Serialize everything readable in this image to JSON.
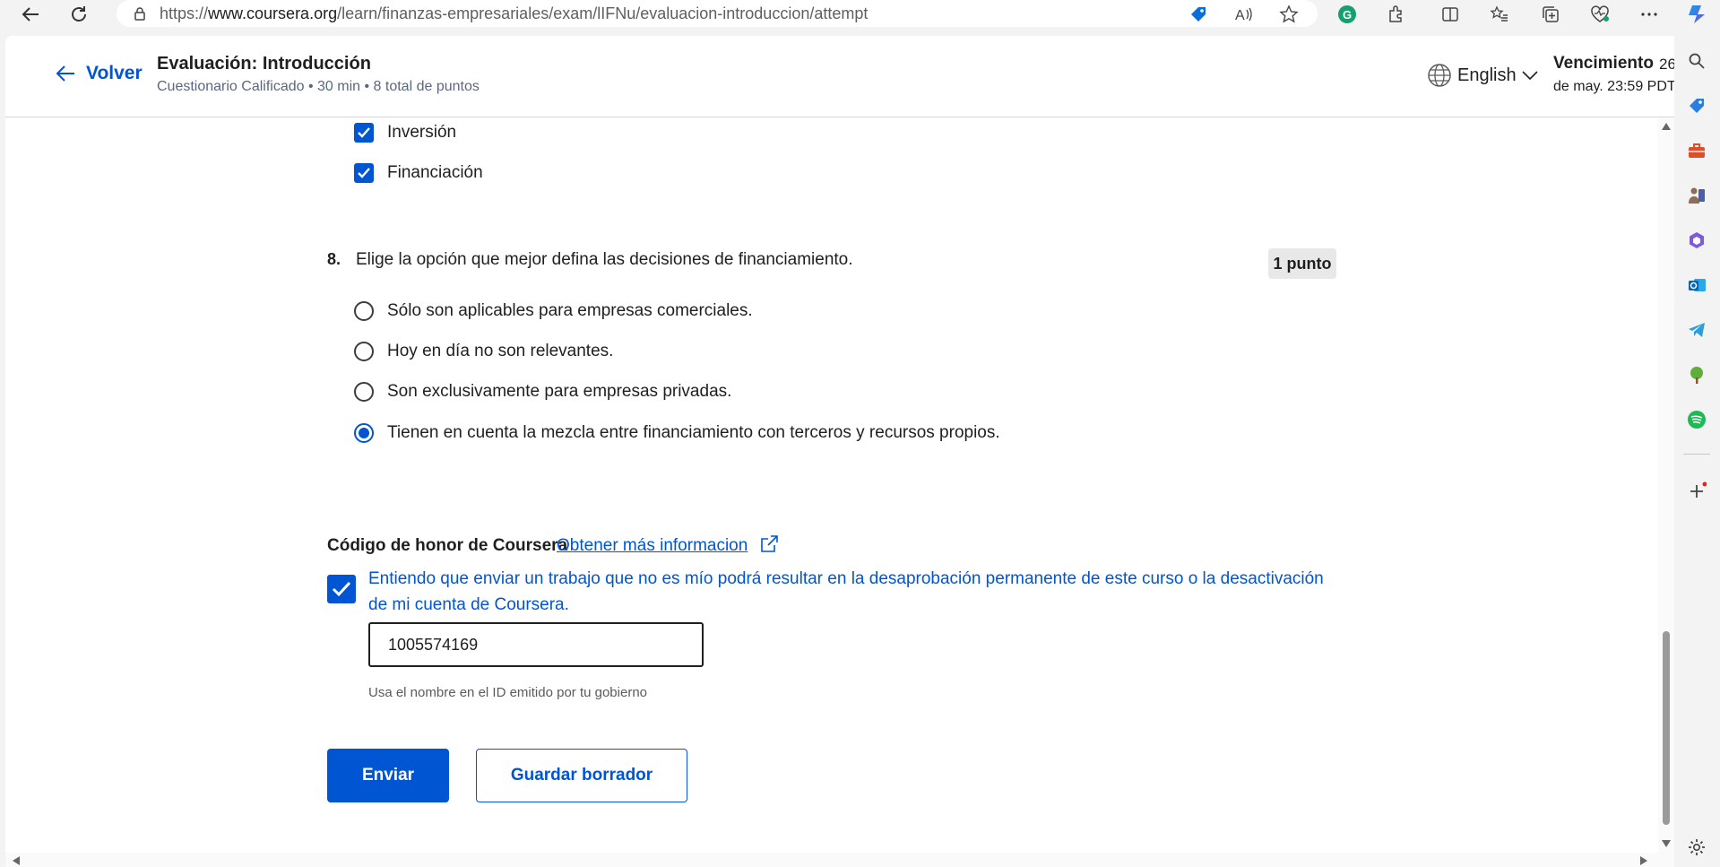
{
  "browser": {
    "url_prefix": "https://",
    "url_domain": "www.coursera.org",
    "url_path": "/learn/finanzas-empresariales/exam/lIFNu/evaluacion-introduccion/attempt"
  },
  "header": {
    "back_label": "Volver",
    "title": "Evaluación: Introducción",
    "subtitle": "Cuestionario Calificado • 30 min • 8 total de puntos",
    "language": "English",
    "due_label": "Vencimiento",
    "due_tail": "26",
    "due_date": "de may. 23:59 PDT"
  },
  "previous_question": {
    "options": [
      {
        "label": "Inversión",
        "checked": true
      },
      {
        "label": "Financiación",
        "checked": true
      }
    ]
  },
  "question": {
    "number": "8.",
    "text": "Elige la opción que mejor defina las decisiones de financiamiento.",
    "points": "1 punto",
    "options": [
      {
        "label": "Sólo son aplicables para empresas comerciales.",
        "selected": false
      },
      {
        "label": "Hoy en día no son relevantes.",
        "selected": false
      },
      {
        "label": "Son exclusivamente para empresas privadas.",
        "selected": false
      },
      {
        "label": "Tienen en cuenta la mezcla entre financiamiento con terceros y recursos propios.",
        "selected": true
      }
    ]
  },
  "honor": {
    "title": "Código de honor de Coursera",
    "link": "Obtener más informacion",
    "statement": "Entiendo que enviar un trabajo que no es mío podrá resultar en la desaprobación permanente de este curso o la desactivación de mi cuenta de Coursera.",
    "checked": true,
    "name_value": "1005574169",
    "help_text": "Usa el nombre en el ID emitido por tu gobierno"
  },
  "actions": {
    "submit": "Enviar",
    "save_draft": "Guardar borrador"
  },
  "colors": {
    "accent": "#0056d2"
  }
}
